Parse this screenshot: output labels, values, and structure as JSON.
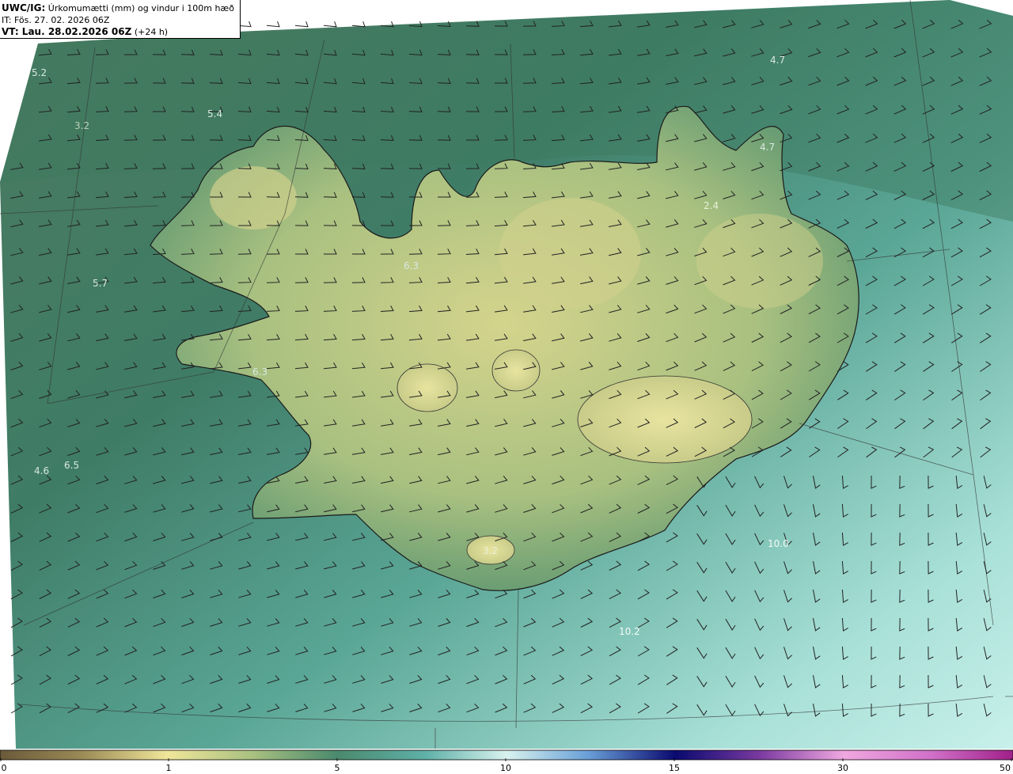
{
  "header": {
    "model": "UWC/IG:",
    "field": "Úrkomumætti (mm) og vindur i 100m hæð",
    "init_time": "IT: Fös. 27. 02. 2026 06Z",
    "valid_prefix": "VT: Lau. 28.02.2026 06Z",
    "valid_suffix": "(+24 h)"
  },
  "colorbar": {
    "ticks": [
      "0",
      "1",
      "5",
      "10",
      "15",
      "30",
      "50"
    ],
    "colors": [
      "#6b5a3a",
      "#9a8a55",
      "#c9c47a",
      "#f0e69a",
      "#a8c080",
      "#5a9a78",
      "#3e8a7a",
      "#5fb0a8",
      "#9fd8d0",
      "#d8f2ee",
      "#6aa0d8",
      "#1a2a9a",
      "#0a0a70",
      "#7a3aa0",
      "#d070c8",
      "#f0a8e0",
      "#c050b0",
      "#a0208a"
    ]
  },
  "map_values": [
    {
      "id": "v1",
      "text": "5.2"
    },
    {
      "id": "v2",
      "text": "3.2"
    },
    {
      "id": "v3",
      "text": "5.4"
    },
    {
      "id": "v4",
      "text": "4.7"
    },
    {
      "id": "v5",
      "text": "4.7"
    },
    {
      "id": "v6",
      "text": "2.4"
    },
    {
      "id": "v7",
      "text": "6.3"
    },
    {
      "id": "v8",
      "text": "5.7"
    },
    {
      "id": "v9",
      "text": "6.3"
    },
    {
      "id": "v10",
      "text": "6.5"
    },
    {
      "id": "v11",
      "text": "4.6"
    },
    {
      "id": "v12",
      "text": "3.2"
    },
    {
      "id": "v13",
      "text": "10.0"
    },
    {
      "id": "v14",
      "text": "10.2"
    }
  ],
  "colors": {
    "ocean_north": "#4f8a6a",
    "ocean_south": "#8fd0c8",
    "land_high": "#d8d890",
    "land_mid": "#9ab878",
    "coast": "#1a1a1a",
    "barb": "#222222"
  }
}
